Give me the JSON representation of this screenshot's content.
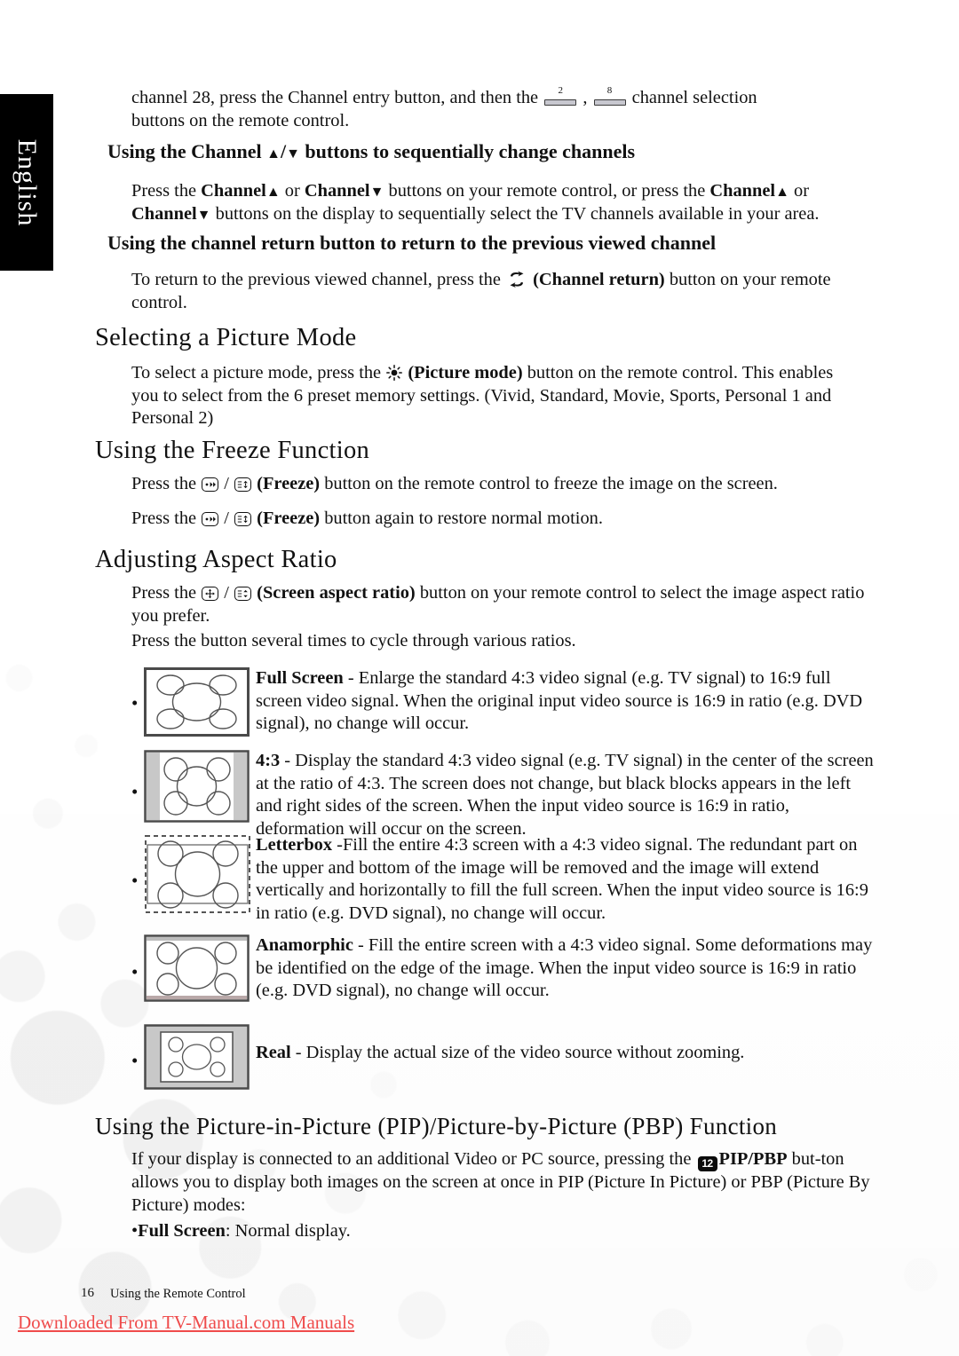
{
  "sidebar": {
    "language_tab": "English"
  },
  "body": {
    "intro_continuation": {
      "before_key1": "channel 28, press the Channel entry button, and then the",
      "key1": "2",
      "between_keys": ",",
      "key2": "8",
      "after_keys": "channel selection",
      "line2": "buttons on the remote control."
    },
    "heading_channel_buttons": {
      "part1": "Using the Channel",
      "up": "▲",
      "slash": "/",
      "down": "▼",
      "part2": "buttons to sequentially change channels"
    },
    "channel_buttons_para": {
      "t1": "Press the",
      "b1": "Channel",
      "up1": "▲",
      "t2": "or",
      "b2": "Channel",
      "down1": "▼",
      "t3": "buttons on your remote control, or press the",
      "b3": "Channel",
      "up2": "▲",
      "t4": "or",
      "b4": "Channel",
      "down2": "▼",
      "t5": "buttons on the display to sequentially select the TV channels available in your area."
    },
    "heading_channel_return": "Using the channel return button to return to the previous viewed channel",
    "channel_return_para": {
      "t1": "To return to the previous viewed channel, press the",
      "icon": "channel-return-icon",
      "b1": "(Channel return)",
      "t2": "button on your remote",
      "t3": "control."
    },
    "heading_picture_mode": "Selecting a Picture Mode",
    "picture_mode_para": {
      "t1": "To select a picture mode, press the",
      "icon": "picture-mode-icon",
      "b1": "(Picture mode)",
      "t2": "button on the remote control. This enables you to select from the 6 preset memory settings. (Vivid, Standard, Movie, Sports, Personal 1 and Personal 2)"
    },
    "heading_freeze": "Using the Freeze Function",
    "freeze_para_1": {
      "t1": "Press the",
      "slash": "/",
      "b1": "(Freeze)",
      "t2": "button on the remote control to freeze the image on the screen."
    },
    "freeze_para_2": {
      "t1": "Press the",
      "slash": "/",
      "b1": "(Freeze)",
      "t2": "button again to restore normal motion."
    },
    "heading_aspect": "Adjusting Aspect Ratio",
    "aspect_para_1": {
      "t1": "Press the",
      "slash": "/",
      "b1": "(Screen aspect ratio)",
      "t2": "button on your remote control to select the image aspect ratio you prefer."
    },
    "aspect_para_2": "Press the button several times to cycle through various ratios.",
    "aspect_items": [
      {
        "bullet": "•",
        "figure": "full-screen-diagram",
        "term": "Full Screen",
        "desc": " - Enlarge the standard 4:3 video signal (e.g. TV signal) to 16:9 full screen video signal. When the original input video source is 16:9 in ratio (e.g. DVD signal), no change will occur."
      },
      {
        "bullet": "•",
        "figure": "four-three-diagram",
        "term": "4:3",
        "desc": "  - Display the standard 4:3 video signal (e.g. TV signal) in the center of the screen at the ratio of 4:3. The screen does not change, but black blocks appears in the left and right sides of the screen. When the input video source is 16:9 in ratio, deformation will occur on the screen."
      },
      {
        "bullet": "•",
        "figure": "letterbox-diagram",
        "term": "Letterbox",
        "desc": " -Fill the entire 4:3 screen with a 4:3 video signal. The redundant part on the upper and bottom of the image will be removed and the image will extend vertically and horizontally to fill the full screen. When the input video source is 16:9 in ratio (e.g. DVD signal), no change will occur."
      },
      {
        "bullet": "•",
        "figure": "anamorphic-diagram",
        "term": "Anamorphic",
        "desc": " - Fill the entire screen with a 4:3 video signal. Some deformations may be identified on the edge of the image. When the input video source is 16:9 in ratio (e.g. DVD signal), no change will occur."
      },
      {
        "bullet": "•",
        "figure": "real-diagram",
        "term": "Real",
        "desc": " - Display the actual size of the video source without zooming."
      }
    ],
    "heading_pip": "Using the Picture-in-Picture (PIP)/Picture-by-Picture (PBP) Function",
    "pip_para": {
      "t1": "If your display is connected to an additional Video or PC source, pressing the",
      "icon_label": "12",
      "b1": "PIP/PBP",
      "t2": "but-ton allows you to display both images on the screen at once in PIP (Picture In Picture) or PBP (Picture By Picture) modes:"
    },
    "pip_bullet": {
      "bullet": "•",
      "term": "Full Screen",
      "desc": ": Normal display."
    }
  },
  "footer": {
    "page_number": "16",
    "section_label": "Using the Remote Control",
    "download_link": "Downloaded From TV-Manual.com Manuals"
  },
  "colors": {
    "link": "#ef4b4b",
    "tab_bg": "#000000",
    "figure_gray": "#c8c8c8"
  }
}
